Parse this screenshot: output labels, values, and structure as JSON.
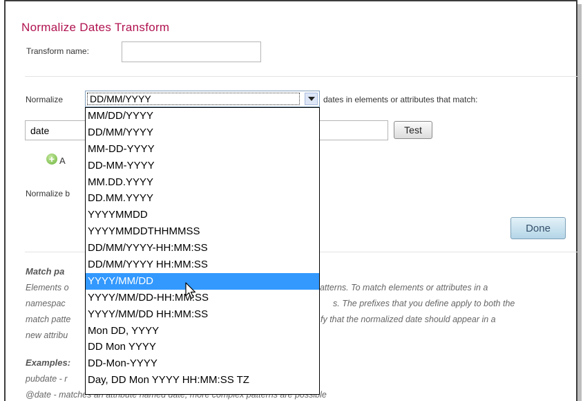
{
  "dialog": {
    "title": "Normalize Dates Transform",
    "transform_name_label": "Transform name:",
    "transform_name_value": ""
  },
  "normalize": {
    "label": "Normalize",
    "selected_format": "DD/MM/YYYY",
    "suffix": "dates in elements or attributes that match:",
    "match_value": "date",
    "test_button": "Test",
    "add_label": "A",
    "normalize_by_label": "Normalize b"
  },
  "done_button": "Done",
  "dropdown_options": [
    "MM/DD/YYYY",
    "DD/MM/YYYY",
    "MM-DD-YYYY",
    "DD-MM-YYYY",
    "MM.DD.YYYY",
    "DD.MM.YYYY",
    "YYYYMMDD",
    "YYYYMMDDTHHMMSS",
    "DD/MM/YYYY-HH:MM:SS",
    "DD/MM/YYYY HH:MM:SS",
    "YYYY/MM/DD",
    "YYYY/MM/DD-HH:MM:SS",
    "YYYY/MM/DD HH:MM:SS",
    "Mon DD, YYYY",
    "DD Mon YYYY",
    "DD-Mon-YYYY",
    "Day, DD Mon YYYY HH:MM:SS TZ"
  ],
  "highlighted_option": "YYYY/MM/DD",
  "help": {
    "match_heading": "Match pa",
    "lines": [
      "Elements o",
      "namespac",
      "match patte",
      "new attribu"
    ],
    "right_lines": [
      "patterns. To match elements or attributes in a",
      "s. The prefixes that you define apply to both the",
      "fy that the normalized date should appear in a"
    ],
    "examples_heading": "Examples:",
    "example1": "pubdate - r",
    "example2": "@date - matches an attribute named date; more complex patterns are possible"
  },
  "icons": {
    "add": "plus-circle-icon",
    "dropdown_arrow": "chevron-down-icon",
    "cursor": "mouse-pointer-icon"
  },
  "colors": {
    "title": "#b0124f",
    "selection": "#3399ff",
    "done_button": "#b4d5e7"
  }
}
